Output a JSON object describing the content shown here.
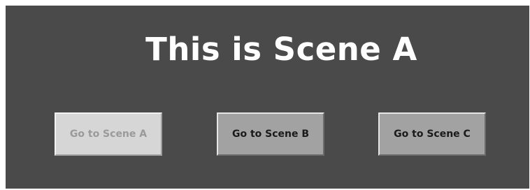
{
  "scene": {
    "title": "This is Scene A"
  },
  "buttons": [
    {
      "label": "Go to Scene A",
      "enabled": false
    },
    {
      "label": "Go to Scene B",
      "enabled": true
    },
    {
      "label": "Go to Scene C",
      "enabled": true
    }
  ],
  "colors": {
    "background": "#4a4a4b",
    "title_text": "#ffffff",
    "button_face": "#a2a2a2",
    "button_disabled_face": "#d6d6d6",
    "button_disabled_text": "#9a9a9a"
  }
}
